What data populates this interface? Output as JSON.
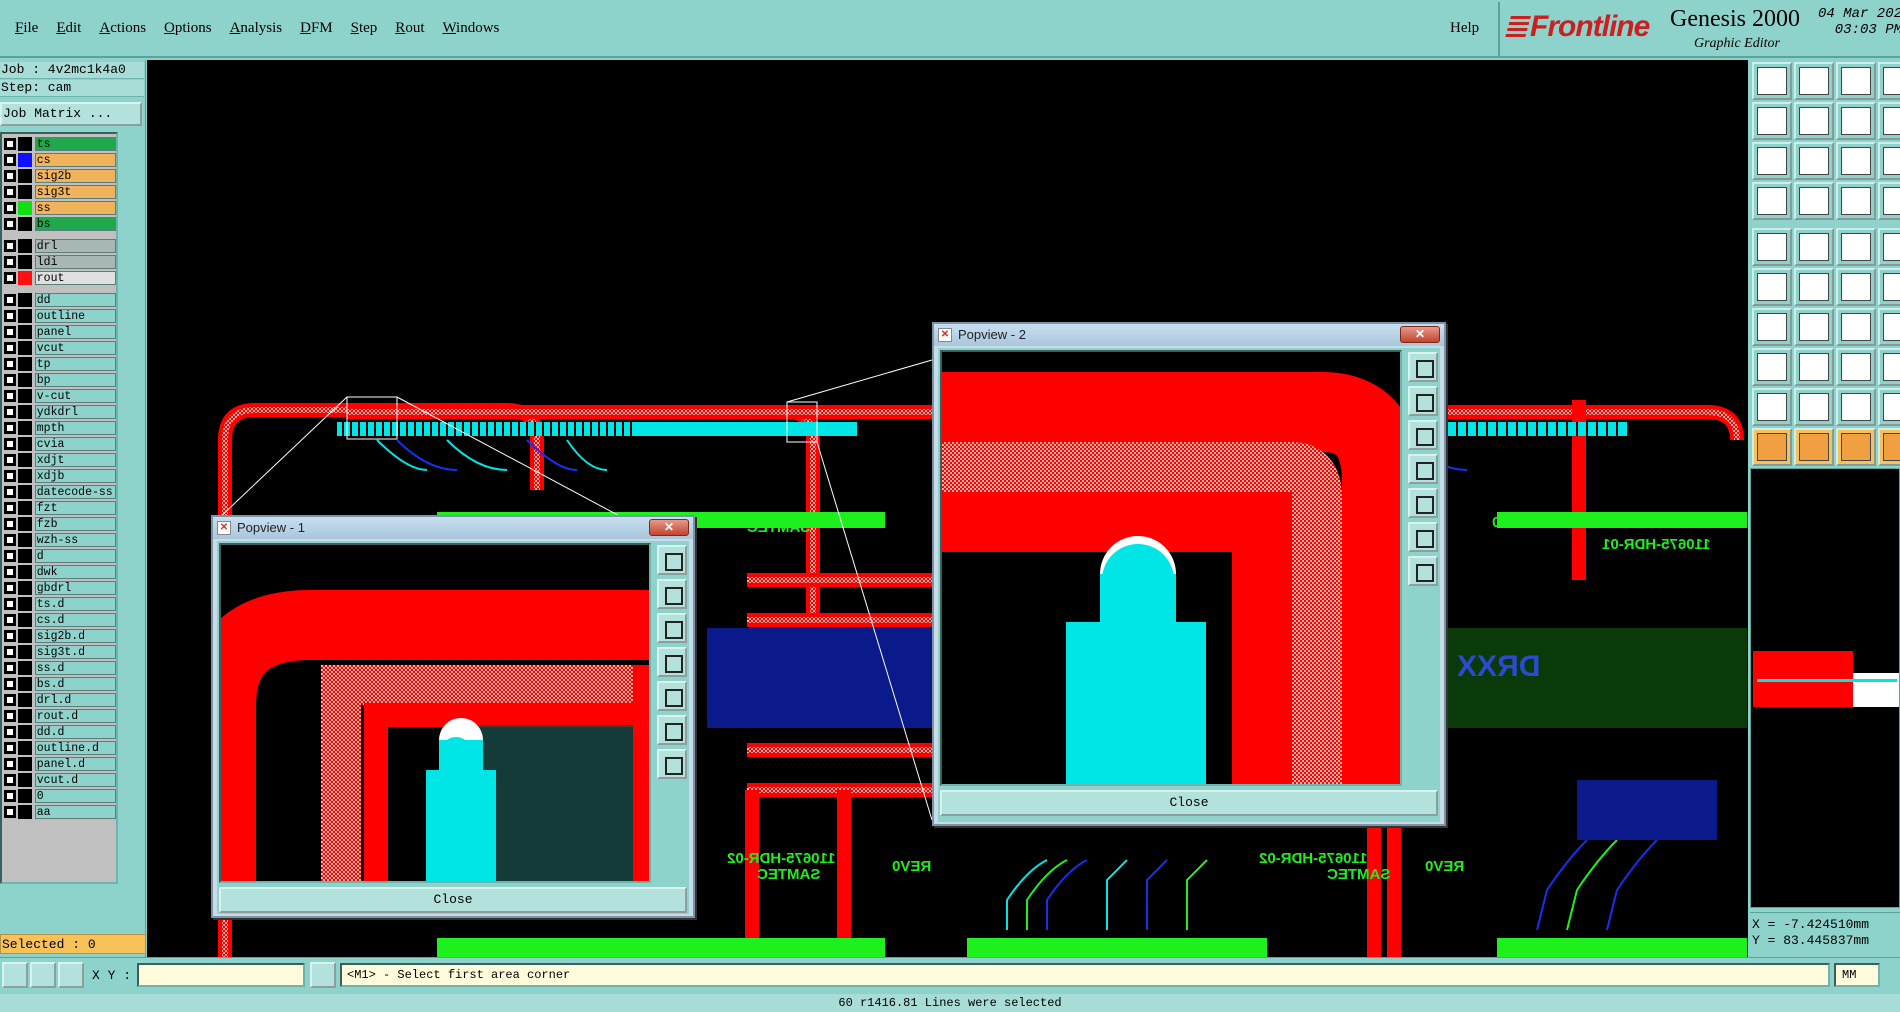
{
  "menu": {
    "items": [
      "File",
      "Edit",
      "Actions",
      "Options",
      "Analysis",
      "DFM",
      "Step",
      "Rout",
      "Windows"
    ],
    "help": "Help"
  },
  "brand": {
    "logo": "Frontline",
    "product": "Genesis 2000",
    "subtitle": "Graphic Editor",
    "date": "04 Mar 202",
    "time": "03:03 PM"
  },
  "job": {
    "job_line": "Job : 4v2mc1k4a0",
    "step_line": "Step: cam",
    "matrix_button": "Job Matrix ..."
  },
  "layers": {
    "group1": [
      {
        "name": "ts",
        "color": "#1fa84c",
        "swatch": ""
      },
      {
        "name": "cs",
        "color": "#f2b45a",
        "swatch": "#1010ff"
      },
      {
        "name": "sig2b",
        "color": "#f2b45a",
        "swatch": ""
      },
      {
        "name": "sig3t",
        "color": "#f2b45a",
        "swatch": ""
      },
      {
        "name": "ss",
        "color": "#f2b45a",
        "swatch": "#10e010"
      },
      {
        "name": "bs",
        "color": "#1fa84c",
        "swatch": ""
      }
    ],
    "group2": [
      {
        "name": "drl",
        "color": "#a7b7b6",
        "swatch": ""
      },
      {
        "name": "ldi",
        "color": "#a7b7b6",
        "swatch": ""
      },
      {
        "name": "rout",
        "color": "#e0e0e0",
        "swatch": "#ff1010"
      }
    ],
    "group3": [
      "dd",
      "outline",
      "panel",
      "vcut",
      "tp",
      "bp",
      "v-cut",
      "ydkdrl",
      "mpth",
      "cvia",
      "xdjt",
      "xdjb",
      "datecode-ss",
      "fzt",
      "fzb",
      "wzh-ss",
      "d",
      "dwk",
      "gbdrl",
      "ts.d",
      "cs.d",
      "sig2b.d",
      "sig3t.d",
      "ss.d",
      "bs.d",
      "drl.d",
      "rout.d",
      "dd.d",
      "outline.d",
      "panel.d",
      "vcut.d",
      "0",
      "aa"
    ],
    "group3_color": "#8ed2cc"
  },
  "selected": "Selected : 0",
  "popview1": {
    "title": "Popview - 1",
    "close": "Close"
  },
  "popview2": {
    "title": "Popview - 2",
    "close": "Close"
  },
  "pcb_labels": {
    "samtec": "SAMTEC",
    "rev": "REV0",
    "hdr01": "110675-HDR-01",
    "hdr02": "110675-HDR-02",
    "drxx": "DRXX"
  },
  "coords": {
    "x": "X = -7.424510mm",
    "y": "Y = 83.445837mm"
  },
  "bottom": {
    "xy_label": "X Y :",
    "xy_value": "",
    "prompt": "<M1> - Select first area corner",
    "units": "MM",
    "status": "60 r1416.81 Lines were selected"
  },
  "colors": {
    "rout_red": "#ff0000",
    "copper_cyan": "#00e5e5",
    "pad_green": "#1ef01e",
    "trace_blue": "#1a2ef0",
    "panel_bg": "#8ed2cc",
    "active_yellow": "#f7c259"
  }
}
